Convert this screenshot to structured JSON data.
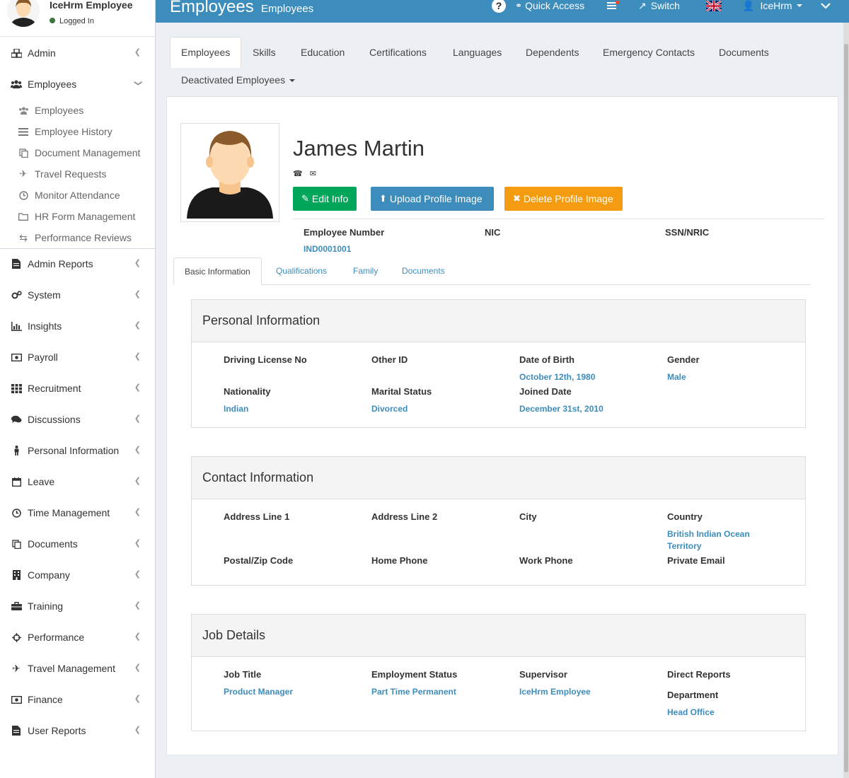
{
  "user_panel": {
    "name": "IceHrm Employee",
    "status": "Logged In"
  },
  "sidebar": {
    "admin": "Admin",
    "employees": "Employees",
    "employees_sub": [
      {
        "label": "Employees",
        "icon": "users-icon"
      },
      {
        "label": "Employee History",
        "icon": "list-icon"
      },
      {
        "label": "Document Management",
        "icon": "files-icon"
      },
      {
        "label": "Travel Requests",
        "icon": "plane-icon"
      },
      {
        "label": "Monitor Attendance",
        "icon": "clock-icon"
      },
      {
        "label": "HR Form Management",
        "icon": "folder-icon"
      },
      {
        "label": "Performance Reviews",
        "icon": "exchange-icon"
      }
    ],
    "items": [
      {
        "label": "Admin Reports",
        "icon": "file-icon"
      },
      {
        "label": "System",
        "icon": "cogs-icon"
      },
      {
        "label": "Insights",
        "icon": "bar-chart-icon"
      },
      {
        "label": "Payroll",
        "icon": "money-icon"
      },
      {
        "label": "Recruitment",
        "icon": "th-icon"
      },
      {
        "label": "Discussions",
        "icon": "comments-icon"
      },
      {
        "label": "Personal Information",
        "icon": "male-icon"
      },
      {
        "label": "Leave",
        "icon": "calendar-icon"
      },
      {
        "label": "Time Management",
        "icon": "clock-icon"
      },
      {
        "label": "Documents",
        "icon": "files-icon"
      },
      {
        "label": "Company",
        "icon": "building-icon"
      },
      {
        "label": "Training",
        "icon": "briefcase-icon"
      },
      {
        "label": "Performance",
        "icon": "crosshairs-icon"
      },
      {
        "label": "Travel Management",
        "icon": "plane-icon"
      },
      {
        "label": "Finance",
        "icon": "money-icon"
      },
      {
        "label": "User Reports",
        "icon": "file-icon"
      }
    ]
  },
  "header": {
    "title": "Employees",
    "subtitle": "Employees",
    "quick_access": "Quick Access",
    "switch": "Switch",
    "user": "IceHrm"
  },
  "main_tabs": [
    "Employees",
    "Skills",
    "Education",
    "Certifications",
    "Languages",
    "Dependents",
    "Emergency Contacts",
    "Documents"
  ],
  "deactivated_tab": "Deactivated Employees",
  "profile": {
    "name": "James Martin",
    "edit_button": "Edit Info",
    "upload_button": "Upload Profile Image",
    "delete_button": "Delete Profile Image",
    "employee_number_label": "Employee Number",
    "employee_number": "IND0001001",
    "nic_label": "NIC",
    "ssn_label": "SSN/NRIC"
  },
  "sub_tabs": [
    "Basic Information",
    "Qualifications",
    "Family",
    "Documents"
  ],
  "personal": {
    "title": "Personal Information",
    "driving_license_label": "Driving License No",
    "other_id_label": "Other ID",
    "dob_label": "Date of Birth",
    "dob": "October 12th, 1980",
    "gender_label": "Gender",
    "gender": "Male",
    "nationality_label": "Nationality",
    "nationality": "Indian",
    "marital_label": "Marital Status",
    "marital": "Divorced",
    "joined_label": "Joined Date",
    "joined": "December 31st, 2010"
  },
  "contact": {
    "title": "Contact Information",
    "address1_label": "Address Line 1",
    "address2_label": "Address Line 2",
    "city_label": "City",
    "country_label": "Country",
    "country": "British Indian Ocean Territory",
    "postal_label": "Postal/Zip Code",
    "home_phone_label": "Home Phone",
    "work_phone_label": "Work Phone",
    "private_email_label": "Private Email"
  },
  "job": {
    "title": "Job Details",
    "job_title_label": "Job Title",
    "job_title": "Product Manager",
    "employment_status_label": "Employment Status",
    "employment_status": "Part Time Permanent",
    "supervisor_label": "Supervisor",
    "supervisor": "IceHrm Employee",
    "direct_reports_label": "Direct Reports",
    "department_label": "Department",
    "department": "Head Office"
  },
  "colors": {
    "header": "#3c8dbc",
    "edit": "#00a65a",
    "upload": "#3c8dbc",
    "delete": "#f39c12",
    "link": "#3c8dbc"
  }
}
